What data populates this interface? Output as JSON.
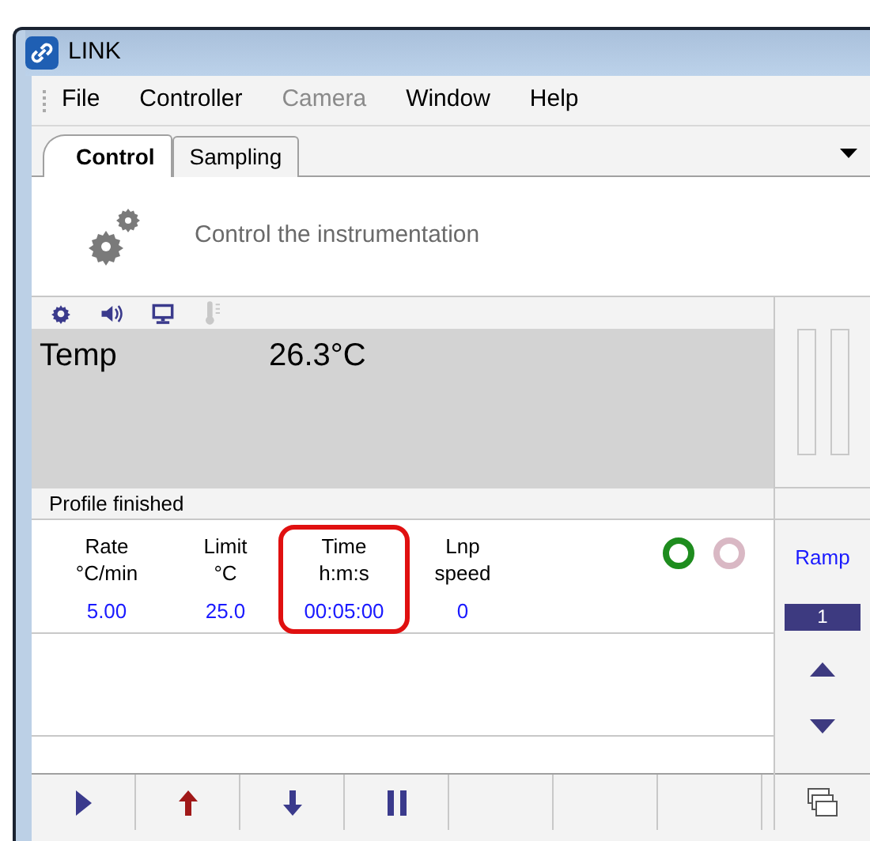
{
  "window": {
    "title": "LINK"
  },
  "menu": [
    {
      "label": "File",
      "disabled": false
    },
    {
      "label": "Controller",
      "disabled": false
    },
    {
      "label": "Camera",
      "disabled": true
    },
    {
      "label": "Window",
      "disabled": false
    },
    {
      "label": "Help",
      "disabled": false
    }
  ],
  "tabs": [
    {
      "label": "Control",
      "selected": true
    },
    {
      "label": "Sampling",
      "selected": false
    }
  ],
  "header": {
    "text": "Control the instrumentation"
  },
  "status_icons": [
    {
      "kind": "gear",
      "disabled": false
    },
    {
      "kind": "speaker",
      "disabled": false
    },
    {
      "kind": "monitor",
      "disabled": false
    },
    {
      "kind": "thermometer",
      "disabled": true
    }
  ],
  "display": {
    "label": "Temp",
    "value": "26.3°C"
  },
  "status": "Profile finished",
  "columns": [
    {
      "title": "Rate",
      "unit": "°C/min",
      "value": "5.00",
      "highlighted": false
    },
    {
      "title": "Limit",
      "unit": "°C",
      "value": "25.0",
      "highlighted": false
    },
    {
      "title": "Time",
      "unit": "h:m:s",
      "value": "00:05:00",
      "highlighted": true
    },
    {
      "title": "Lnp",
      "unit": "speed",
      "value": "0",
      "highlighted": false
    }
  ],
  "indicators": [
    {
      "color": "#1e8c1e"
    },
    {
      "color": "#d9b8c4"
    }
  ],
  "side": {
    "label": "Ramp",
    "number": "1"
  },
  "toolbar": [
    {
      "kind": "play"
    },
    {
      "kind": "up"
    },
    {
      "kind": "down"
    },
    {
      "kind": "pause"
    },
    {
      "kind": "empty"
    },
    {
      "kind": "empty"
    },
    {
      "kind": "empty"
    }
  ]
}
